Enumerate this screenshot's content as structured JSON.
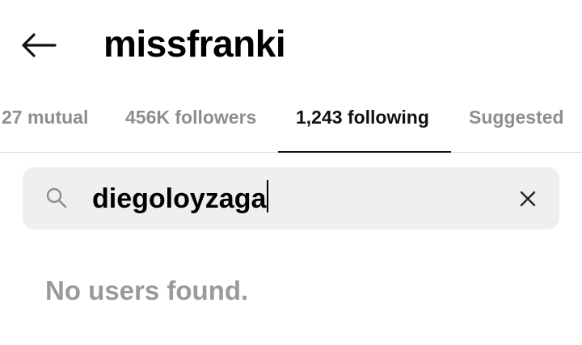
{
  "header": {
    "title": "missfranki",
    "back_icon": "arrow-left-icon"
  },
  "tabs": [
    {
      "label": "27 mutual",
      "active": false
    },
    {
      "label": "456K followers",
      "active": false
    },
    {
      "label": "1,243 following",
      "active": true
    },
    {
      "label": "Suggested",
      "active": false
    }
  ],
  "search": {
    "value": "diegoloyzaga",
    "icon": "search-icon",
    "clear_icon": "close-icon"
  },
  "results": {
    "empty_message": "No users found."
  },
  "colors": {
    "active_tab": "#111111",
    "inactive_tab": "#8e8e8e",
    "search_bg": "#efefef",
    "empty_text": "#9a9a9a",
    "divider": "#d8d8d8"
  }
}
